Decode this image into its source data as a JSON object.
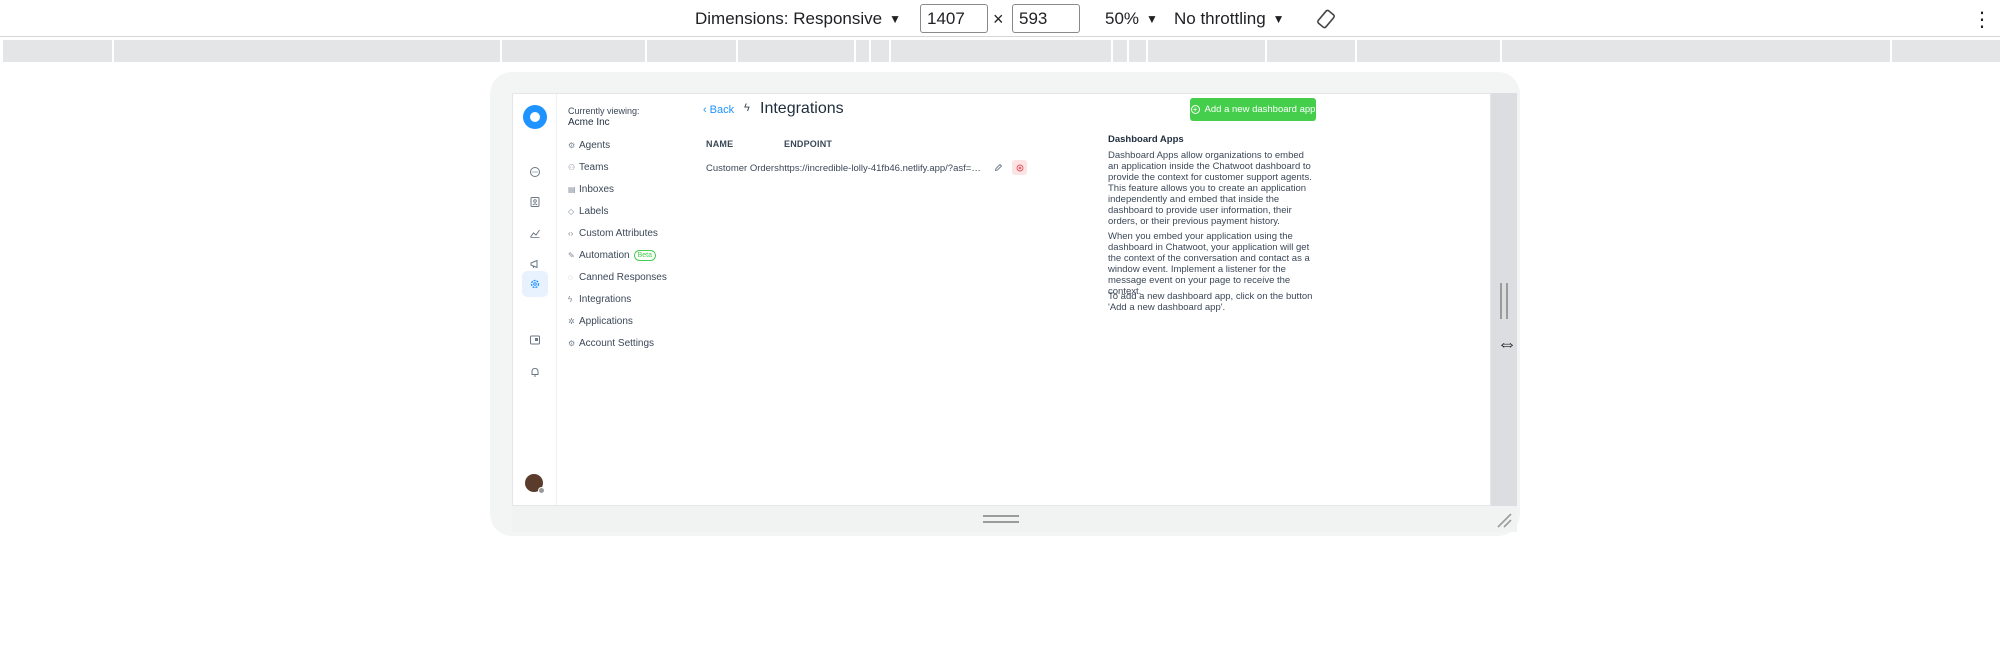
{
  "devtools": {
    "dimensions_label": "Dimensions: Responsive",
    "width_value": "1407",
    "height_value": "593",
    "times": "×",
    "zoom_label": "50%",
    "throttle_label": "No throttling",
    "caret": "▼",
    "rotate_icon": "⟳",
    "menu_icon": "⋮"
  },
  "app": {
    "rail_icons": [
      "conversations-icon",
      "contacts-icon",
      "reports-icon",
      "campaigns-icon",
      "settings-icon",
      "help-center-icon",
      "notifications-icon"
    ],
    "sidebar": {
      "viewing_label": "Currently viewing:",
      "account_name": "Acme Inc",
      "items": [
        {
          "label": "Agents",
          "icon": "agents-icon"
        },
        {
          "label": "Teams",
          "icon": "teams-icon"
        },
        {
          "label": "Inboxes",
          "icon": "inboxes-icon"
        },
        {
          "label": "Labels",
          "icon": "labels-icon"
        },
        {
          "label": "Custom Attributes",
          "icon": "custom-attributes-icon"
        },
        {
          "label": "Automation",
          "icon": "automation-icon",
          "badge": "Beta"
        },
        {
          "label": "Canned Responses",
          "icon": "canned-responses-icon"
        },
        {
          "label": "Integrations",
          "icon": "integrations-icon"
        },
        {
          "label": "Applications",
          "icon": "applications-icon"
        },
        {
          "label": "Account Settings",
          "icon": "account-settings-icon"
        }
      ]
    },
    "header": {
      "back_label": "Back",
      "title": "Integrations",
      "add_button_label": "Add a new dashboard app"
    },
    "table": {
      "columns": [
        "NAME",
        "ENDPOINT"
      ],
      "rows": [
        {
          "name": "Customer Orders",
          "endpoint": "https://incredible-lolly-41fb46.netlify.app/?asf=asdf=..."
        }
      ]
    },
    "info": {
      "title": "Dashboard Apps",
      "p1": "Dashboard Apps allow organizations to embed an application inside the Chatwoot dashboard to provide the context for customer support agents. This feature allows you to create an application independently and embed that inside the dashboard to provide user information, their orders, or their previous payment history.",
      "p2": "When you embed your application using the dashboard in Chatwoot, your application will get the context of the conversation and contact as a window event. Implement a listener for the message event on your page to receive the context.",
      "p3": "To add a new dashboard app, click on the button 'Add a new dashboard app'."
    }
  },
  "colors": {
    "accent": "#1f93ff",
    "success": "#44ce4b",
    "danger": "#e0565f"
  }
}
